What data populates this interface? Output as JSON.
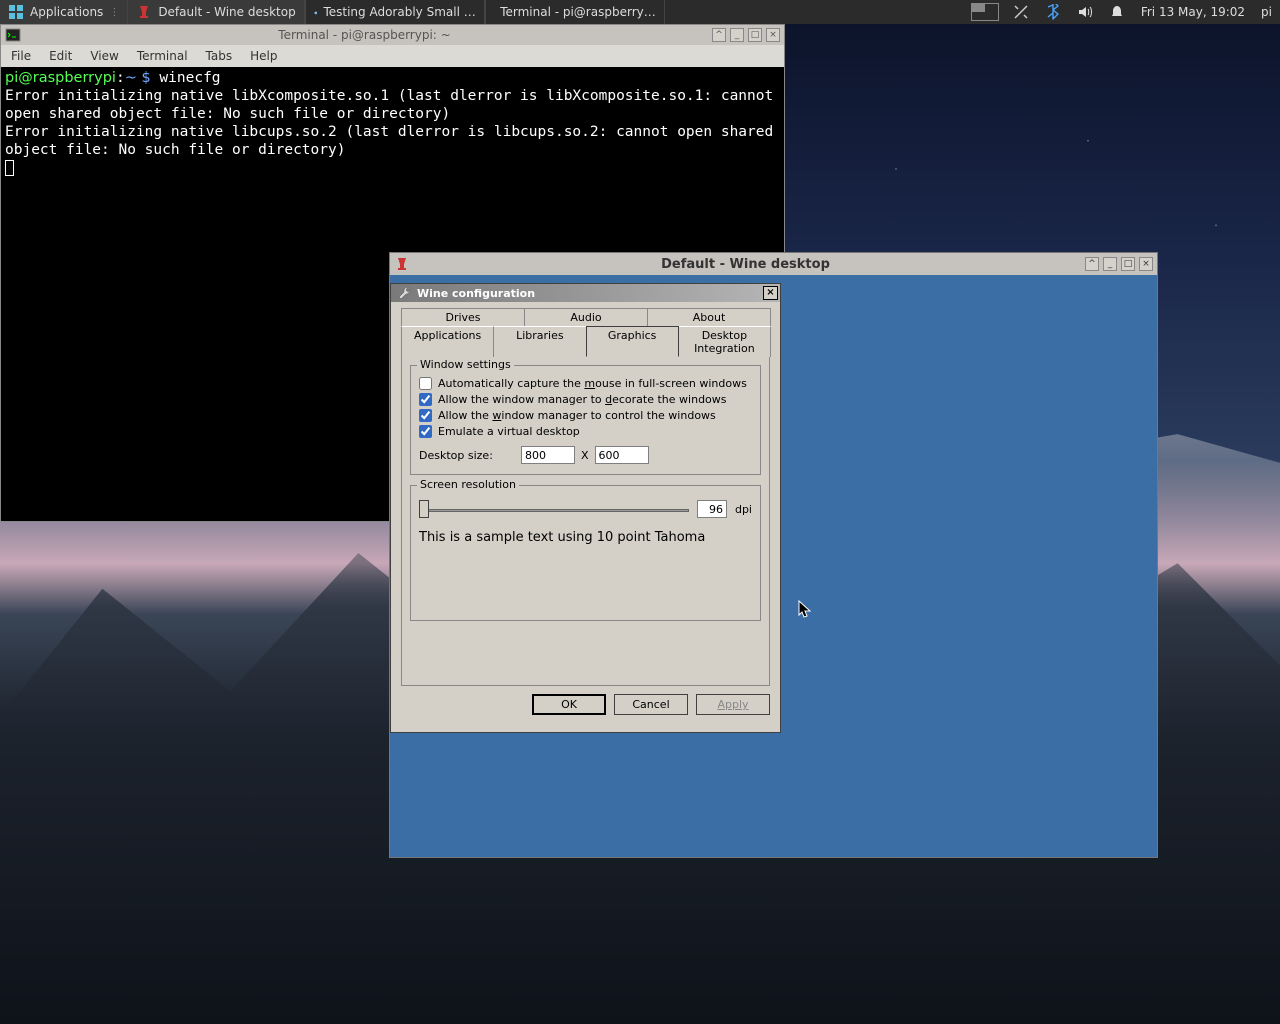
{
  "panel": {
    "applications_label": "Applications",
    "tasks": [
      {
        "label": "Default - Wine desktop",
        "icon": "wine"
      },
      {
        "label": "Testing Adorably Small …",
        "icon": "globe"
      },
      {
        "label": "Terminal - pi@raspberry…",
        "icon": "terminal"
      }
    ],
    "clock": "Fri 13 May, 19:02",
    "user": "pi"
  },
  "terminal": {
    "title": "Terminal - pi@raspberrypi: ~",
    "menus": [
      "File",
      "Edit",
      "View",
      "Terminal",
      "Tabs",
      "Help"
    ],
    "prompt_user": "pi@raspberrypi",
    "prompt_path": "~",
    "prompt_symbol": "$",
    "command": "winecfg",
    "output": "Error initializing native libXcomposite.so.1 (last dlerror is libXcomposite.so.1: cannot open shared object file: No such file or directory)\nError initializing native libcups.so.2 (last dlerror is libcups.so.2: cannot open shared object file: No such file or directory)"
  },
  "wine_window": {
    "title": "Default - Wine desktop"
  },
  "winecfg": {
    "title": "Wine configuration",
    "tabs_row1": [
      "Drives",
      "Audio",
      "About"
    ],
    "tabs_row2": [
      "Applications",
      "Libraries",
      "Graphics",
      "Desktop Integration"
    ],
    "active_tab": "Graphics",
    "window_settings": {
      "legend": "Window settings",
      "capture_mouse": {
        "label": "Automatically capture the mouse in full-screen windows",
        "checked": false,
        "accel": "m"
      },
      "decorate": {
        "label": "Allow the window manager to decorate the windows",
        "checked": true,
        "accel": "d"
      },
      "control": {
        "label": "Allow the window manager to control the windows",
        "checked": true,
        "accel": "w"
      },
      "emulate": {
        "label": "Emulate a virtual desktop",
        "checked": true
      },
      "desktop_size_label": "Desktop size:",
      "width": "800",
      "x_label": "X",
      "height": "600"
    },
    "screen_resolution": {
      "legend": "Screen resolution",
      "dpi": "96",
      "dpi_label": "dpi",
      "sample_text": "This is a sample text using 10 point Tahoma"
    },
    "buttons": {
      "ok": "OK",
      "cancel": "Cancel",
      "apply": "Apply"
    }
  }
}
